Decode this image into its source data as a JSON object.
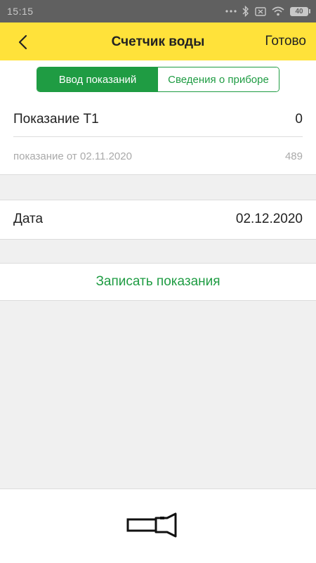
{
  "status_bar": {
    "time": "15:15",
    "battery": "40",
    "icons": [
      "more-icon",
      "bluetooth-icon",
      "sim-icon",
      "wifi-icon",
      "battery-icon"
    ]
  },
  "header": {
    "title": "Счетчик воды",
    "done_label": "Готово",
    "back_icon": "chevron-left-icon",
    "background": "#ffe23a"
  },
  "tabs": {
    "items": [
      {
        "label": "Ввод показаний",
        "selected": true
      },
      {
        "label": "Сведения о приборе",
        "selected": false
      }
    ],
    "accent": "#1f9c43"
  },
  "reading": {
    "label": "Показание Т1",
    "value": "0",
    "previous_label": "показание от 02.11.2020",
    "previous_value": "489"
  },
  "date": {
    "label": "Дата",
    "value": "02.12.2020"
  },
  "submit": {
    "label": "Записать показания"
  },
  "bottom": {
    "icon": "flashlight-icon"
  }
}
